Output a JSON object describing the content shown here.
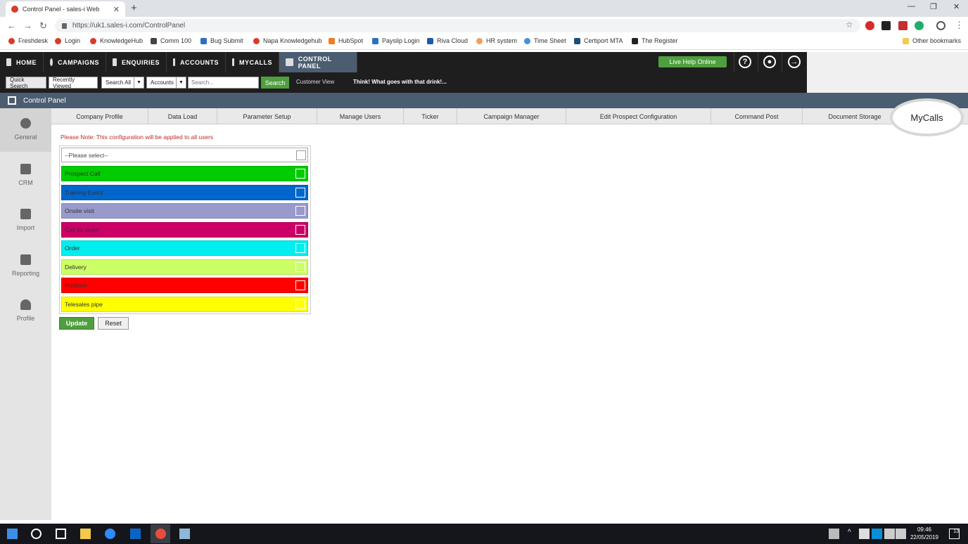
{
  "browser": {
    "tab_title": "Control Panel - sales-i Web",
    "url": "https://uk1.sales-i.com/ControlPanel",
    "bookmarks": [
      "Freshdesk",
      "Login",
      "KnowledgeHub",
      "Comm 100",
      "Bug Submit",
      "Napa Knowledgehub",
      "HubSpot",
      "Payslip Login",
      "Riva Cloud",
      "HR system",
      "Time Sheet",
      "Certiport MTA",
      "The Register"
    ],
    "other_bookmarks": "Other bookmarks"
  },
  "nav": {
    "items": [
      "HOME",
      "CAMPAIGNS",
      "ENQUIRIES",
      "ACCOUNTS",
      "MYCALLS",
      "CONTROL PANEL"
    ],
    "live_help": "Live Help Online"
  },
  "search": {
    "quick_search": "Quick Search",
    "recently_viewed": "Recently Viewed",
    "scope": "Search All",
    "entity": "Accounts",
    "placeholder": "Search...",
    "go": "Search",
    "customer_view": "Customer View",
    "ticker": "Think! What goes with that drink!..."
  },
  "page": {
    "title": "Control Panel"
  },
  "sidebar": {
    "items": [
      "General",
      "CRM",
      "Import",
      "Reporting",
      "Profile"
    ]
  },
  "tabs": [
    "Company Profile",
    "Data Load",
    "Parameter Setup",
    "Manage Users",
    "Ticker",
    "Campaign Manager",
    "Edit Prospect Configuration",
    "Command Post",
    "Document Storage",
    "MyCalls"
  ],
  "content": {
    "note": "Please Note: This configuration will be applied to all users",
    "select_placeholder": "--Please select--",
    "call_types": [
      {
        "label": "Prospect Call",
        "color": "#00cc00"
      },
      {
        "label": "Training Event",
        "color": "#0066cc"
      },
      {
        "label": "Onsite visit",
        "color": "#9999cc"
      },
      {
        "label": "Call for order",
        "color": "#cc0066"
      },
      {
        "label": "Order",
        "color": "#00eeee"
      },
      {
        "label": "Delivery",
        "color": "#ccff66"
      },
      {
        "label": "Problem",
        "color": "#ff0000"
      },
      {
        "label": "Telesales pipe",
        "color": "#ffff00"
      }
    ],
    "update": "Update",
    "reset": "Reset"
  },
  "taskbar": {
    "time": "09:46",
    "date": "22/05/2019",
    "notifications": "13"
  }
}
